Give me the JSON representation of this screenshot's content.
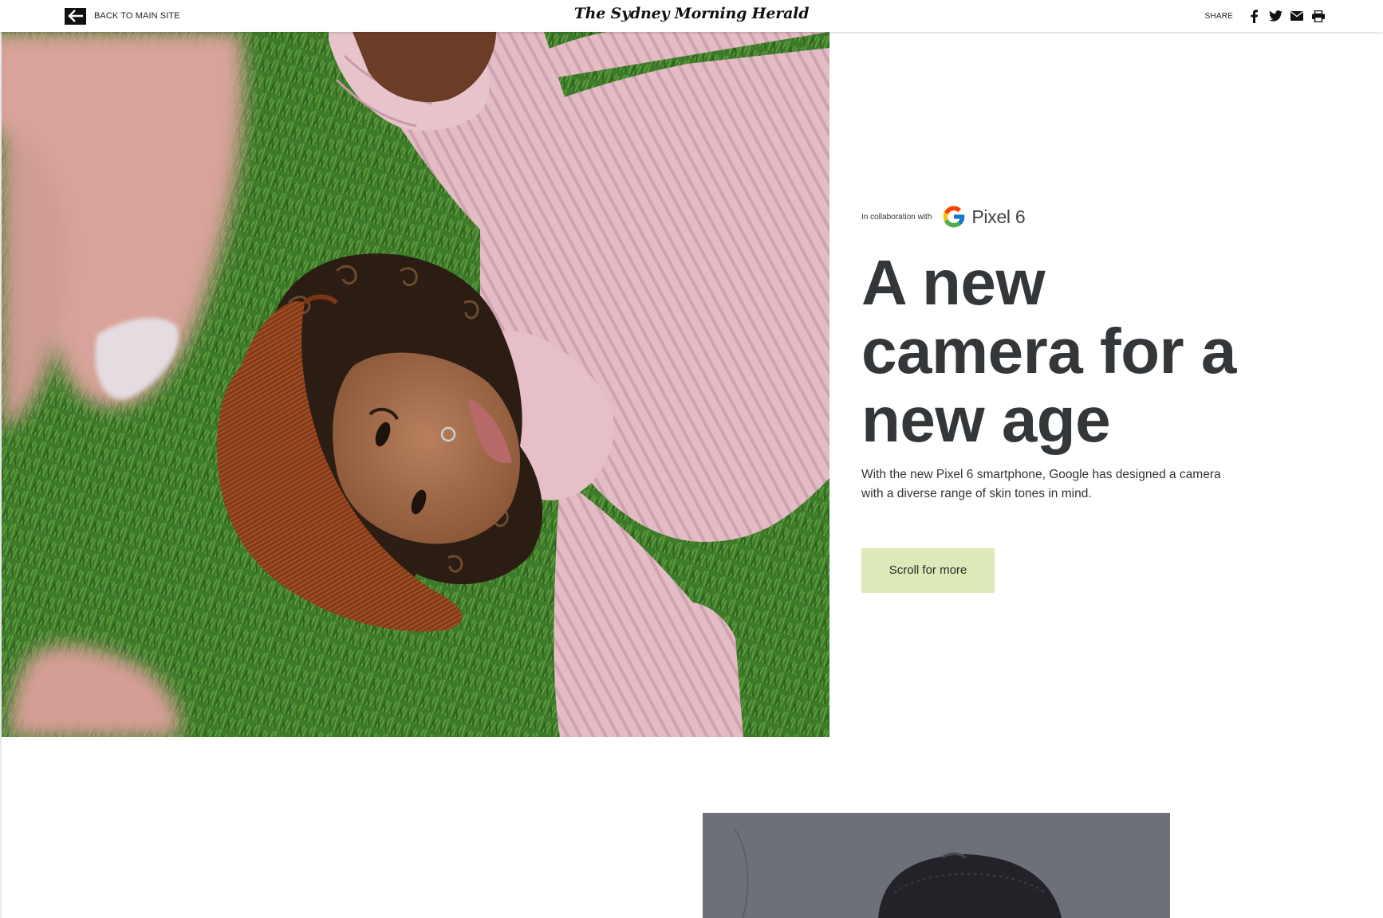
{
  "header": {
    "back_label": "BACK TO MAIN SITE",
    "masthead": "The Sydney Morning Herald",
    "share_label": "SHARE",
    "share_buttons": [
      "facebook-icon",
      "twitter-icon",
      "email-icon",
      "print-icon"
    ]
  },
  "hero": {
    "collab_label": "In collaboration with",
    "brand_label": "Pixel 6",
    "headline": "A new camera for a new age",
    "standfirst": "With the new Pixel 6 smartphone, Google has designed a camera with a diverse range of skin tones in mind.",
    "cta_label": "Scroll for more"
  },
  "colors": {
    "cta_background": "#dde9b8",
    "headline": "#34373a",
    "grass": "#3e7a2c",
    "sweater": "#e2b9c4",
    "hat": "#9a4a22"
  }
}
